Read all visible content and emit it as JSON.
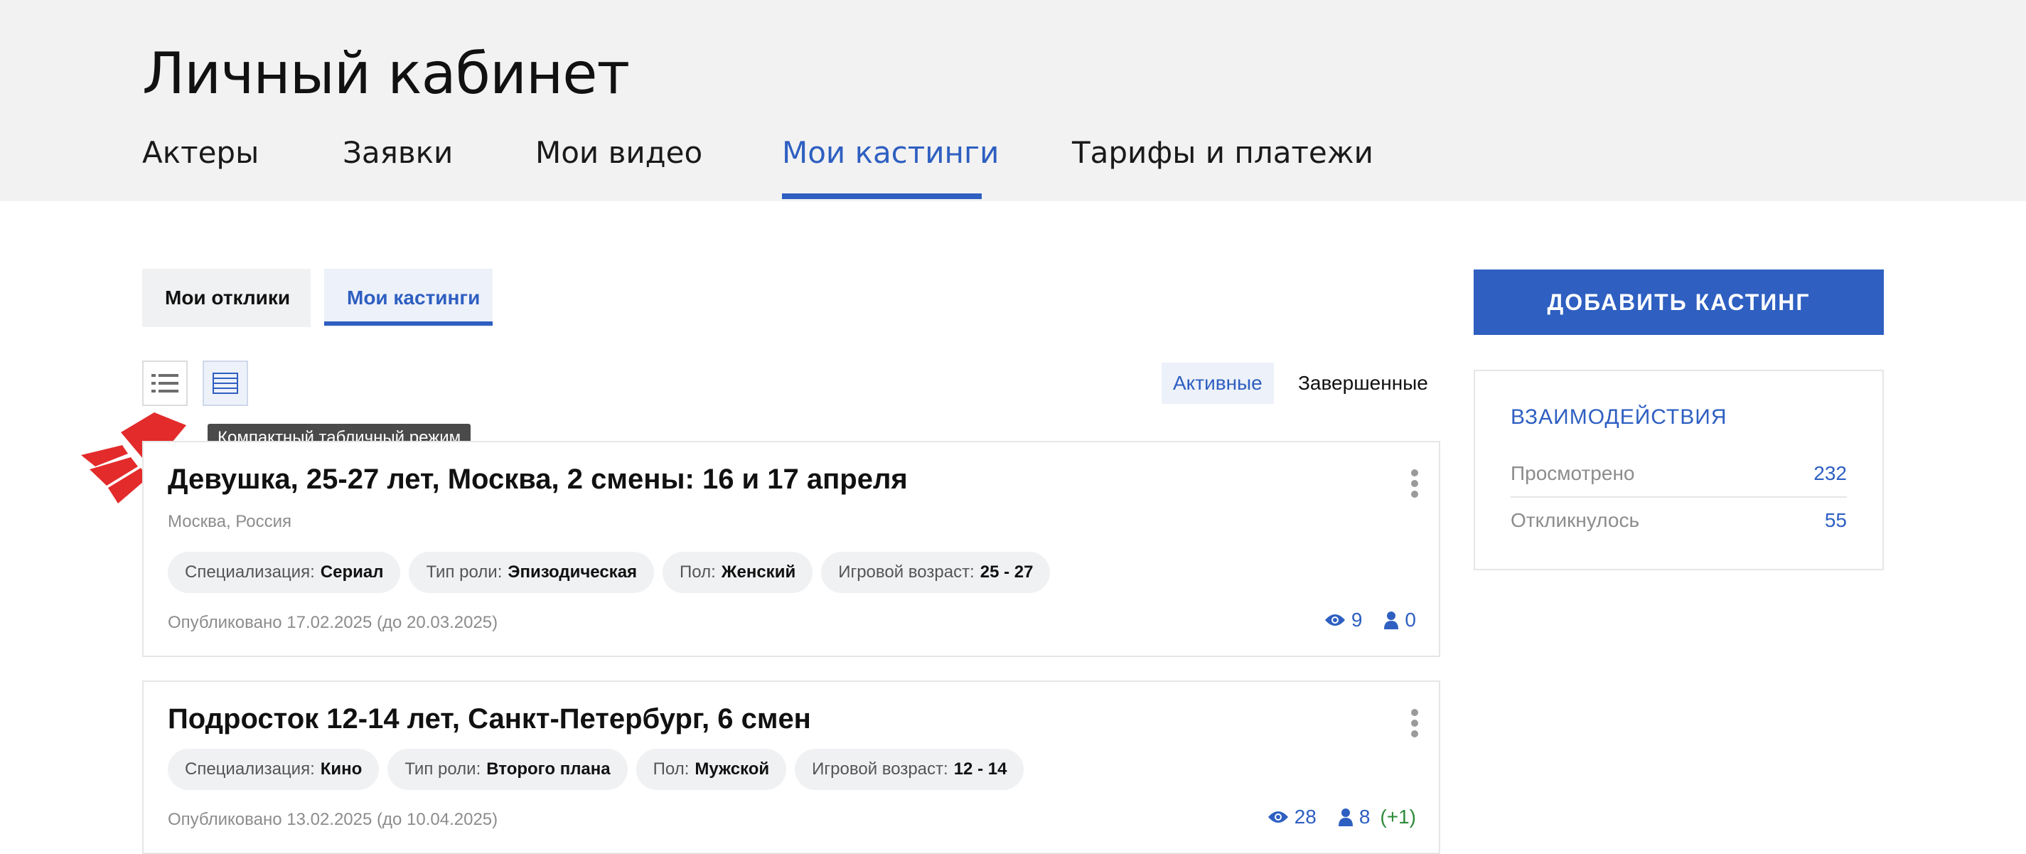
{
  "page": {
    "title": "Личный кабинет"
  },
  "nav": {
    "items": [
      {
        "label": "Актеры"
      },
      {
        "label": "Заявки"
      },
      {
        "label": "Мои видео"
      },
      {
        "label": "Мои кастинги",
        "active": true
      },
      {
        "label": "Тарифы и платежи"
      }
    ]
  },
  "subtabs": {
    "responses": "Мои отклики",
    "castings": "Мои кастинги",
    "active": "castings"
  },
  "view_modes": {
    "tooltip": "Компактный табличный режим",
    "list_icon": "list-icon",
    "table_icon": "table-icon"
  },
  "filters": {
    "active_label": "Активные",
    "finished_label": "Завершенные"
  },
  "castings": [
    {
      "title": "Девушка, 25-27 лет, Москва, 2 смены: 16 и 17 апреля",
      "location": "Москва, Россия",
      "tags": [
        {
          "key": "Специализация:",
          "value": "Сериал"
        },
        {
          "key": "Тип роли:",
          "value": "Эпизодическая"
        },
        {
          "key": "Пол:",
          "value": "Женский"
        },
        {
          "key": "Игровой возраст:",
          "value": "25 - 27"
        }
      ],
      "published": "Опубликовано 17.02.2025 (до 20.03.2025)",
      "views": "9",
      "applicants": "0",
      "applicants_delta": ""
    },
    {
      "title": "Подросток 12-14 лет, Санкт-Петербург, 6 смен",
      "location": "",
      "tags": [
        {
          "key": "Специализация:",
          "value": "Кино"
        },
        {
          "key": "Тип роли:",
          "value": "Второго плана"
        },
        {
          "key": "Пол:",
          "value": "Мужской"
        },
        {
          "key": "Игровой возраст:",
          "value": "12 - 14"
        }
      ],
      "published": "Опубликовано 13.02.2025 (до 10.04.2025)",
      "views": "28",
      "applicants": "8",
      "applicants_delta": "(+1)"
    }
  ],
  "sidebar": {
    "add_button": "ДОБАВИТЬ КАСТИНГ",
    "interactions_title": "ВЗАИМОДЕЙСТВИЯ",
    "rows": [
      {
        "label": "Просмотрено",
        "value": "232"
      },
      {
        "label": "Откликнулось",
        "value": "55"
      }
    ]
  },
  "colors": {
    "accent": "#2e5fc1",
    "positive": "#2e8b3a",
    "arrow_red": "#e32b2b"
  }
}
